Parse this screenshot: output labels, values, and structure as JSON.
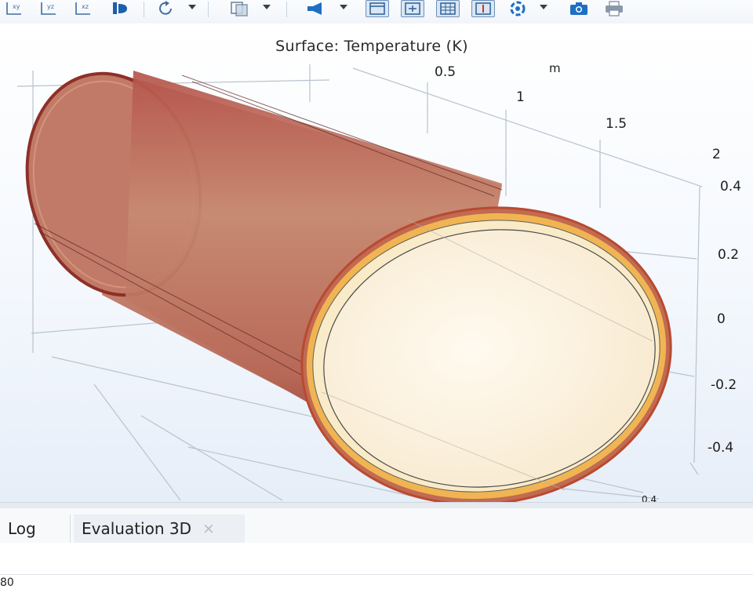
{
  "toolbar": {
    "buttons": [
      {
        "name": "xy-view",
        "text": "xy"
      },
      {
        "name": "yz-view",
        "text": "yz"
      },
      {
        "name": "xz-view",
        "text": "xz"
      },
      {
        "name": "go-to-view"
      },
      {
        "name": "rotate"
      },
      {
        "name": "transparency"
      },
      {
        "name": "light"
      },
      {
        "name": "scene-light-view"
      },
      {
        "name": "zoom-extents"
      },
      {
        "name": "grid"
      },
      {
        "name": "axis"
      },
      {
        "name": "render-settings"
      },
      {
        "name": "snapshot"
      },
      {
        "name": "print"
      }
    ],
    "colors": {
      "icon": "#3f6f9f",
      "blue": "#1d6fc3",
      "boxed": "#d9e7f5"
    }
  },
  "plot": {
    "title": "Surface: Temperature (K)",
    "axes": {
      "x_unit": "m",
      "x_ticks": [
        "0.5",
        "1",
        "1.5",
        "2"
      ],
      "z_ticks": [
        "0.4",
        "0.2",
        "0",
        "-0.2",
        "-0.4"
      ],
      "y_partial_tick": "0.4"
    },
    "colors": {
      "cylinder_outer": "#b85a4f",
      "cylinder_shade": "#8e3028",
      "cap_face": "#fcf2dc",
      "rim": "#e8a243"
    }
  },
  "bottom_panel": {
    "tabs": [
      {
        "label": "Log"
      },
      {
        "label": "Evaluation 3D",
        "close": "×"
      }
    ],
    "status_value": "80"
  }
}
